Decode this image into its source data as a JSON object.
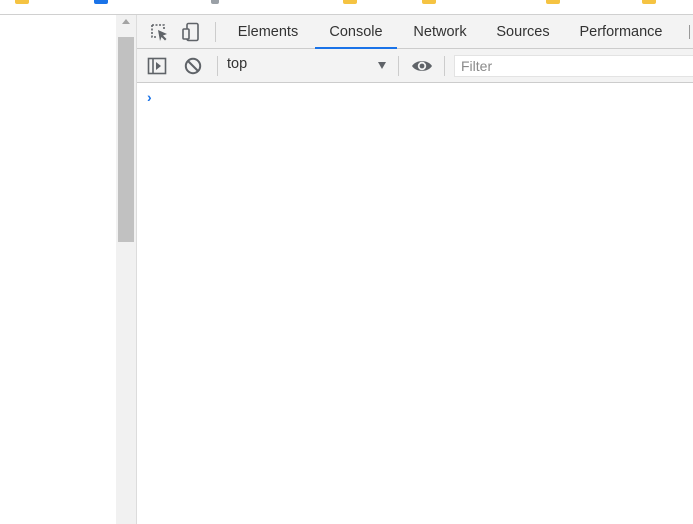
{
  "devtools": {
    "tabs": [
      {
        "label": "Elements",
        "active": false
      },
      {
        "label": "Console",
        "active": true
      },
      {
        "label": "Network",
        "active": false
      },
      {
        "label": "Sources",
        "active": false
      },
      {
        "label": "Performance",
        "active": false
      }
    ],
    "icons": {
      "inspect": "inspect-element-icon",
      "device": "device-toolbar-icon",
      "sidebar": "console-sidebar-icon",
      "clear": "clear-console-icon",
      "eye": "live-expression-eye-icon",
      "prompt": "console-prompt-chevron-icon"
    },
    "accent_color": "#1a73e8"
  },
  "console": {
    "context": "top",
    "filter_placeholder": "Filter",
    "filter_value": ""
  }
}
